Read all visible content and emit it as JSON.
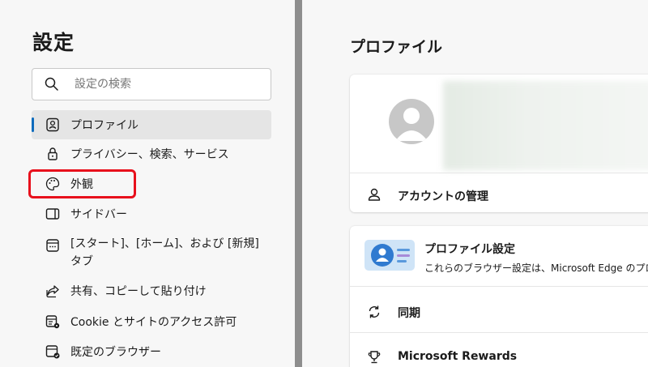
{
  "settings": {
    "title": "設定",
    "search_placeholder": "設定の検索"
  },
  "sidebar": {
    "items": [
      {
        "label": "プロファイル",
        "icon": "profile-icon",
        "active": true
      },
      {
        "label": "プライバシー、検索、サービス",
        "icon": "lock-icon"
      },
      {
        "label": "外観",
        "icon": "palette-icon",
        "highlighted": true
      },
      {
        "label": "サイドバー",
        "icon": "sidebar-icon"
      },
      {
        "label": "[スタート]、[ホーム]、および [新規] タブ",
        "icon": "new-tab-icon"
      },
      {
        "label": "共有、コピーして貼り付け",
        "icon": "share-icon"
      },
      {
        "label": "Cookie とサイトのアクセス許可",
        "icon": "site-permissions-icon"
      },
      {
        "label": "既定のブラウザー",
        "icon": "default-browser-icon"
      }
    ],
    "accent_color": "#0f6cbd",
    "highlight_color": "#e8101c"
  },
  "main": {
    "page_title": "プロファイル",
    "account_manage": "アカウントの管理",
    "profile_settings": {
      "title": "プロファイル設定",
      "description": "これらのブラウザー設定は、Microsoft Edge のプロ"
    },
    "sync": "同期",
    "rewards": "Microsoft Rewards"
  }
}
